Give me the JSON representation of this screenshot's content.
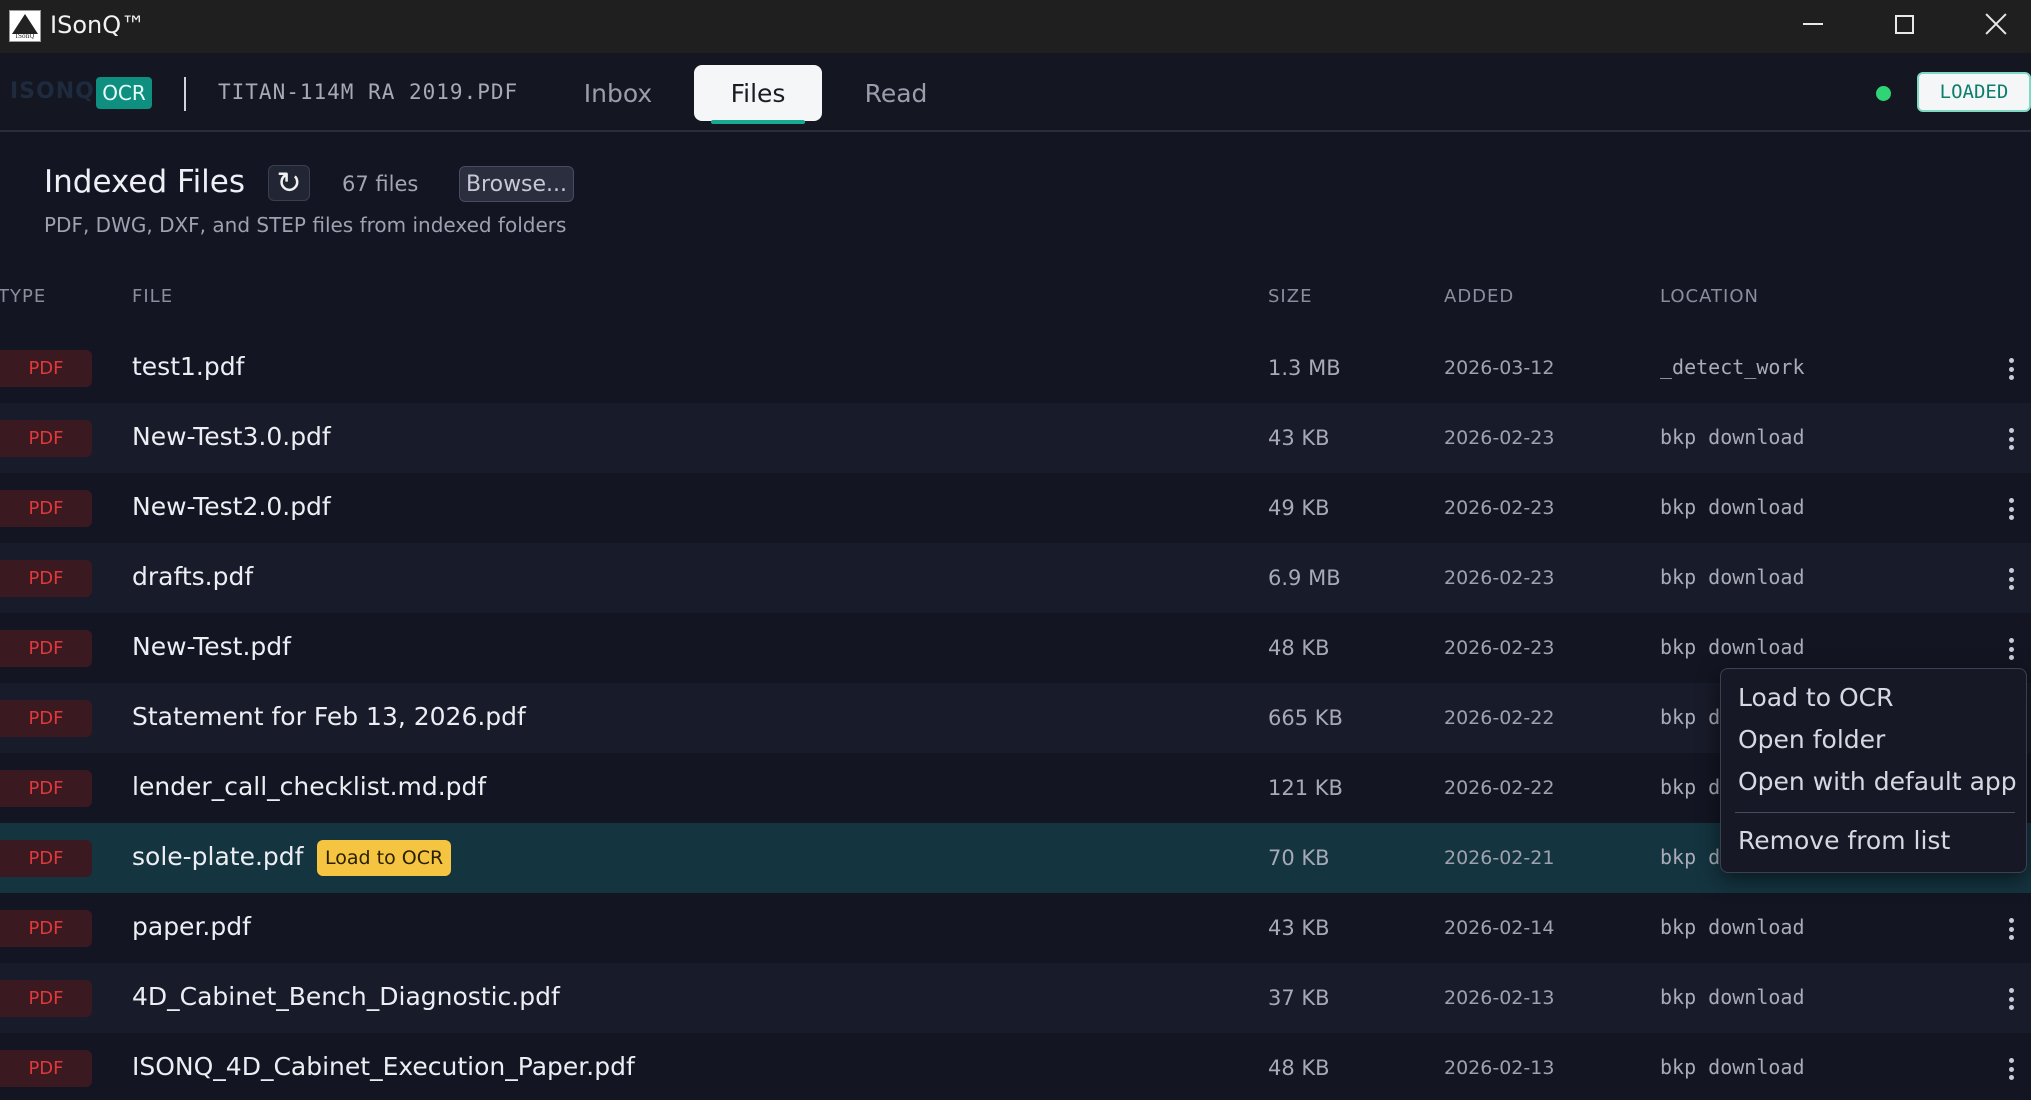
{
  "window": {
    "title": "ISonQ™",
    "logo_text": "ISonQ"
  },
  "header": {
    "ghost_brand": "ISONQ",
    "ocr_badge": "OCR",
    "document": "TITAN-114M RA 2019.PDF",
    "tabs": [
      {
        "label": "Inbox",
        "active": false
      },
      {
        "label": "Files",
        "active": true
      },
      {
        "label": "Read",
        "active": false
      }
    ],
    "status": "LOADED"
  },
  "page": {
    "title": "Indexed Files",
    "refresh_glyph": "↻",
    "count": "67 files",
    "browse_label": "Browse...",
    "subtitle": "PDF, DWG, DXF, and STEP files from indexed folders"
  },
  "table": {
    "columns": {
      "type": "TYPE",
      "file": "FILE",
      "size": "SIZE",
      "added": "ADDED",
      "location": "LOCATION"
    },
    "rows": [
      {
        "type": "PDF",
        "file": "test1.pdf",
        "size": "1.3 MB",
        "added": "2026-03-12",
        "location": "_detect_work"
      },
      {
        "type": "PDF",
        "file": "New-Test3.0.pdf",
        "size": "43 KB",
        "added": "2026-02-23",
        "location": "bkp download"
      },
      {
        "type": "PDF",
        "file": "New-Test2.0.pdf",
        "size": "49 KB",
        "added": "2026-02-23",
        "location": "bkp download"
      },
      {
        "type": "PDF",
        "file": "drafts.pdf",
        "size": "6.9 MB",
        "added": "2026-02-23",
        "location": "bkp download"
      },
      {
        "type": "PDF",
        "file": "New-Test.pdf",
        "size": "48 KB",
        "added": "2026-02-23",
        "location": "bkp download"
      },
      {
        "type": "PDF",
        "file": "Statement for Feb 13, 2026.pdf",
        "size": "665 KB",
        "added": "2026-02-22",
        "location": "bkp d"
      },
      {
        "type": "PDF",
        "file": "lender_call_checklist.md.pdf",
        "size": "121 KB",
        "added": "2026-02-22",
        "location": "bkp d"
      },
      {
        "type": "PDF",
        "file": "sole-plate.pdf",
        "size": "70 KB",
        "added": "2026-02-21",
        "location": "bkp d",
        "tag": "Load to OCR"
      },
      {
        "type": "PDF",
        "file": "paper.pdf",
        "size": "43 KB",
        "added": "2026-02-14",
        "location": "bkp download"
      },
      {
        "type": "PDF",
        "file": "4D_Cabinet_Bench_Diagnostic.pdf",
        "size": "37 KB",
        "added": "2026-02-13",
        "location": "bkp download"
      },
      {
        "type": "PDF",
        "file": "ISONQ_4D_Cabinet_Execution_Paper.pdf",
        "size": "48 KB",
        "added": "2026-02-13",
        "location": "bkp download"
      }
    ]
  },
  "context_menu": {
    "items": [
      "Load to OCR",
      "Open folder",
      "Open with default app",
      "Remove from list"
    ]
  },
  "colors": {
    "accent": "#19a892",
    "pdf_badge": "#e0393b",
    "status_ok": "#2fd575",
    "ocr_tag": "#f5c542"
  }
}
